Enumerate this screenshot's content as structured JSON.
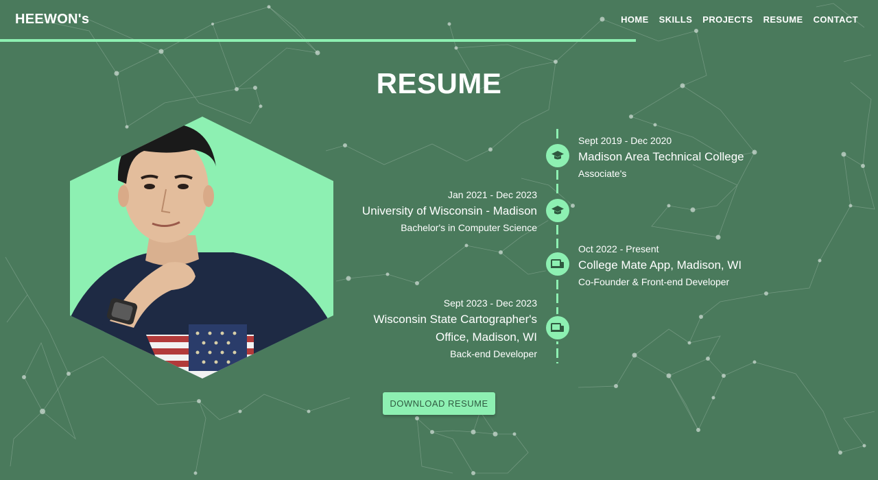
{
  "header": {
    "brand": "HEEWON's",
    "nav": [
      "HOME",
      "SKILLS",
      "PROJECTS",
      "RESUME",
      "CONTACT"
    ]
  },
  "page": {
    "title": "RESUME"
  },
  "timeline": [
    {
      "date": "Sept 2019 - Dec 2020",
      "title": "Madison Area Technical College",
      "subtitle": "Associate's",
      "icon": "graduation-cap-icon"
    },
    {
      "date": "Jan 2021 - Dec 2023",
      "title": "University of Wisconsin - Madison",
      "subtitle": "Bachelor's in Computer Science",
      "icon": "graduation-cap-icon"
    },
    {
      "date": "Oct 2022 - Present",
      "title": "College Mate App, Madison, WI",
      "subtitle": "Co-Founder & Front-end Developer",
      "icon": "devices-icon"
    },
    {
      "date": "Sept 2023 - Dec 2023",
      "title": "Wisconsin State Cartographer's Office, Madison, WI",
      "subtitle": "Back-end Developer",
      "icon": "devices-icon"
    }
  ],
  "download": {
    "label": "DOWNLOAD RESUME"
  },
  "colors": {
    "background": "#4a7a5c",
    "accent": "#8df0b2",
    "text": "#ffffff"
  }
}
